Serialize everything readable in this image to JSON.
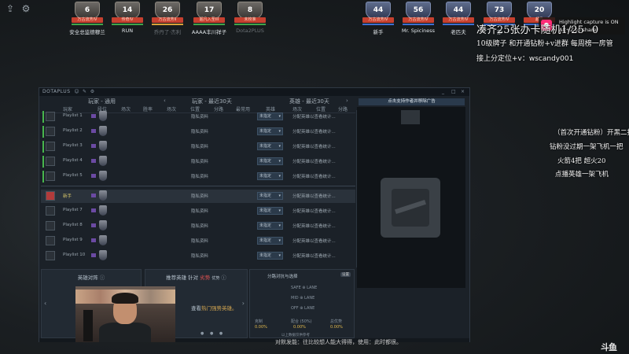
{
  "stream": {
    "top_left_icons": [
      "upload-icon",
      "gear-icon"
    ],
    "radiant_slots": [
      {
        "level": "6",
        "rank": "万古流芳IV",
        "name": "安全总监德穆兰",
        "bar": "#3fa44a",
        "dim": false
      },
      {
        "level": "14",
        "rank": "传奇IV",
        "name": "RUN",
        "bar": "#3fa44a",
        "dim": false
      },
      {
        "level": "26",
        "rank": "万古流芳II",
        "name": "乔丹了·杰利",
        "bar": "#d8a23a",
        "dim": true
      },
      {
        "level": "17",
        "rank": "超凡入圣III",
        "name": "AAAA丰川祥子",
        "bar": "#3fa44a",
        "dim": false
      },
      {
        "level": "8",
        "rank": "未校准",
        "name": "Dota2PLUS",
        "bar": "#3fa44a",
        "dim": true
      }
    ],
    "dire_slots": [
      {
        "level": "44",
        "rank": "万古流芳IV",
        "name": "新手",
        "bar": "#3d6fd0",
        "dim": false
      },
      {
        "level": "56",
        "rank": "万古流芳IV",
        "name": "Mr. Spiciness",
        "bar": "#3d6fd0",
        "dim": false
      },
      {
        "level": "44",
        "rank": "万古流芳IV",
        "name": "老匹夫",
        "bar": "#3d6fd0",
        "dim": false
      },
      {
        "level": "73",
        "rank": "万古流芳IV",
        "name": "亦",
        "bar": "#3d6fd0",
        "dim": false
      },
      {
        "level": "20",
        "rank": "超凡",
        "name": "",
        "bar": "#3d6fd0",
        "dim": false
      }
    ],
    "capture_notice": {
      "line1": "Highlight capture is ON",
      "line2": "Alt+Z to share"
    },
    "overlay_lines": {
      "title": "凑齐25张办卡随机1/25",
      "title_count": "0",
      "line2": "10级牌子 和开通钻粉+v进群   每周榜一房管",
      "line3": "接上分定位+v：wscandy001",
      "side1": "（首次开通钻粉）开黑二把",
      "side2": "钻粉没过期一架飞机一把",
      "side3": "火箭4把  超火20",
      "side4": "点播英雄一架飞机"
    },
    "chat_line": "对默发能：往比较想人能大得得，使用：此时都很。",
    "platform_logo": "斗鱼"
  },
  "app": {
    "brand": "DOTAPLUS",
    "titlebar_icons": [
      "user-icon",
      "note-icon",
      "gear-icon"
    ],
    "window_controls": [
      "_",
      "□",
      "×"
    ],
    "groups": [
      "玩家 - 通用",
      "玩家 - 最近30天",
      "英雄 - 最近30天"
    ],
    "columns_left": [
      "玩家",
      "段位",
      "场次",
      "胜率"
    ],
    "columns_mid": [
      "场次",
      "位置",
      "分路",
      "最常用"
    ],
    "columns_right": [
      "英雄",
      "场次",
      "位置",
      "分路"
    ],
    "rows": [
      {
        "name": "Playlist 1",
        "me": false,
        "mark": true
      },
      {
        "name": "Playlist 2",
        "me": false,
        "mark": true
      },
      {
        "name": "Playlist 3",
        "me": false,
        "mark": true
      },
      {
        "name": "Playlist 4",
        "me": false,
        "mark": true
      },
      {
        "name": "Playlist 5",
        "me": false,
        "mark": true
      },
      {
        "name": "新手",
        "me": true,
        "mark": false
      },
      {
        "name": "Playlist 7",
        "me": false,
        "mark": false
      },
      {
        "name": "Playlist 8",
        "me": false,
        "mark": false
      },
      {
        "name": "Playlist 9",
        "me": false,
        "mark": false
      },
      {
        "name": "Playlist 10",
        "me": false,
        "mark": false
      }
    ],
    "hidden_text": "隐私资料",
    "select_value": "未指定",
    "hint_text": "分配英雄以查看统计...",
    "ad_button": "点击支持作者并移除广告",
    "panel_hero_title": "英雄对阵",
    "panel_rec_title_a": "推荐英雄 针对",
    "panel_rec_title_b": "劣势",
    "panel_rec_title_c": "优势",
    "panel_rec_body_a": "查看",
    "panel_rec_body_b": "热门强势英雄。",
    "stats_title": "分路对抗与选择",
    "stats_tag": "设置",
    "stats_lanes": [
      "SAFE ⊕ LANE",
      "MID ⊕ LANE",
      "OFF ⊕ LANE"
    ],
    "stats_labels": [
      "克制",
      "配合 (50%)",
      "总优势"
    ],
    "stats_values": [
      "0.00%",
      "0.00%",
      "0.00%"
    ],
    "stats_footer": "以上数据仅供参考"
  }
}
